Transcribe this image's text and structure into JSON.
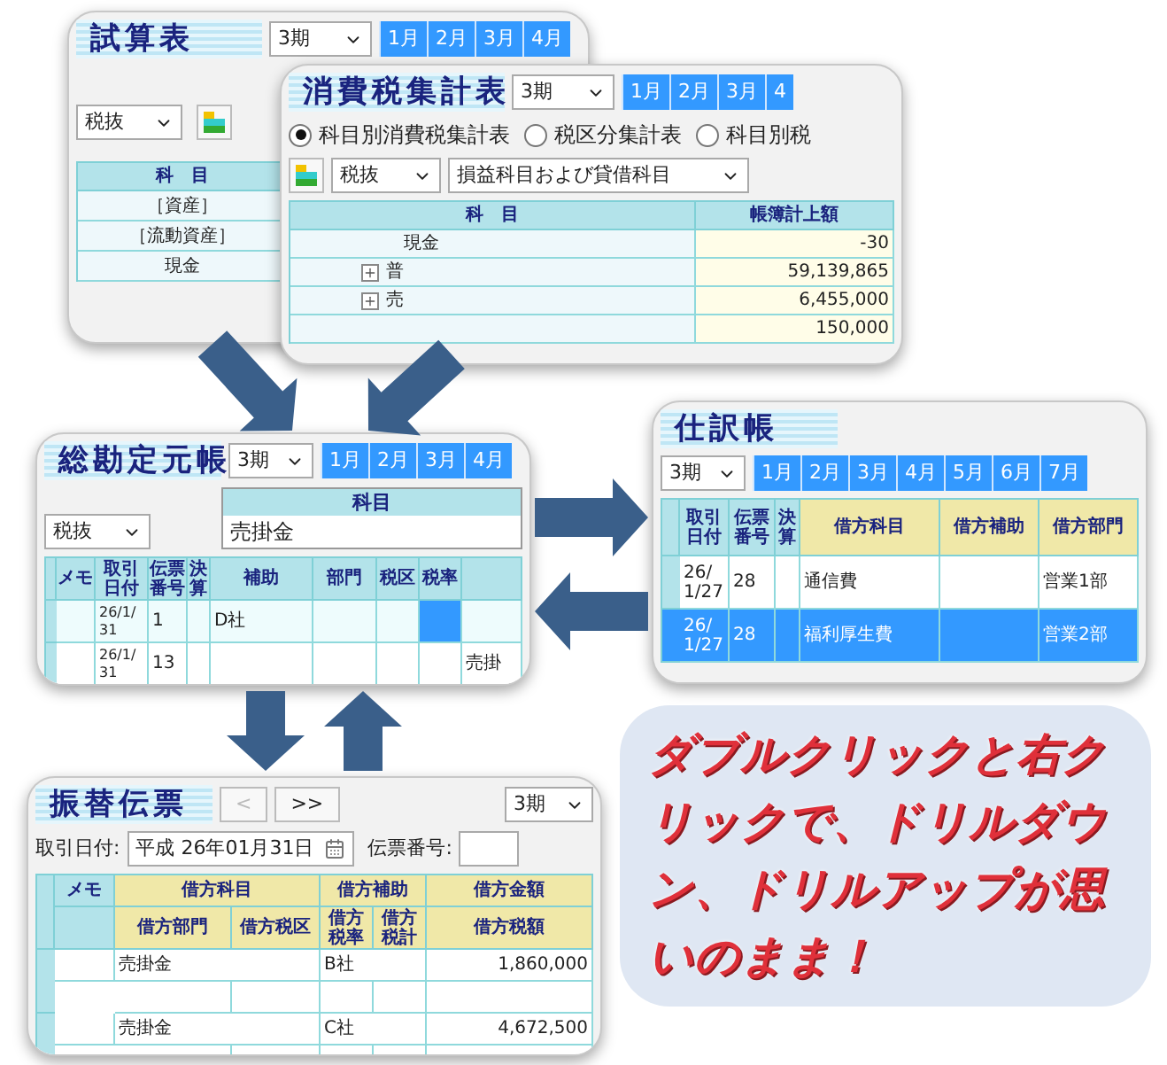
{
  "trial_balance": {
    "title": "試算表",
    "period": "3期",
    "months": [
      "1月",
      "2月",
      "3月",
      "4月"
    ],
    "tax_mode": "税抜",
    "table": {
      "columns": [
        "科　目"
      ],
      "rows": [
        "［資産］",
        "［流動資産］",
        "現金"
      ]
    }
  },
  "consumption_tax": {
    "title": "消費税集計表",
    "period": "3期",
    "months": [
      "1月",
      "2月",
      "3月",
      "4"
    ],
    "radios": [
      {
        "label": "科目別消費税集計表",
        "selected": true
      },
      {
        "label": "税区分集計表",
        "selected": false
      },
      {
        "label": "科目別税",
        "selected": false
      }
    ],
    "tax_mode": "税抜",
    "scope": "損益科目および貸借科目",
    "table": {
      "columns": [
        "科　目",
        "帳簿計上額"
      ],
      "rows": [
        {
          "name": "現金",
          "expandable": false,
          "amount": "-30"
        },
        {
          "name": "普",
          "expandable": true,
          "amount": "59,139,865"
        },
        {
          "name": "売",
          "expandable": true,
          "amount": "6,455,000"
        },
        {
          "expandable": false,
          "amount": "150,000"
        }
      ]
    }
  },
  "general_ledger": {
    "title": "総勘定元帳",
    "period": "3期",
    "months": [
      "1月",
      "2月",
      "3月",
      "4月"
    ],
    "tax_mode": "税抜",
    "account_label": "科目",
    "account": "売掛金",
    "table": {
      "columns": [
        "メモ",
        "取引日付",
        "伝票番号",
        "決算",
        "補助",
        "部門",
        "税区",
        "税率"
      ],
      "rows": [
        {
          "date": "26/1/31",
          "slip_no": "1",
          "sub_account": "D社",
          "selected": true
        },
        {
          "date": "26/1/31",
          "slip_no": "13",
          "column_9": "売掛",
          "selected": false
        }
      ]
    }
  },
  "journal": {
    "title": "仕訳帳",
    "period": "3期",
    "months": [
      "1月",
      "2月",
      "3月",
      "4月",
      "5月",
      "6月",
      "7月"
    ],
    "table": {
      "columns": [
        "取引日付",
        "伝票番号",
        "決算",
        "借方科目",
        "借方補助",
        "借方部門"
      ],
      "rows": [
        {
          "date": "26/1/27",
          "slip_no": "28",
          "account": "通信費",
          "department": "営業1部",
          "selected": false
        },
        {
          "date": "26/1/27",
          "slip_no": "28",
          "account": "福利厚生費",
          "department": "営業2部",
          "selected": true
        }
      ]
    }
  },
  "transfer_slip": {
    "title": "振替伝票",
    "nav": [
      {
        "label": "<",
        "disabled": true
      },
      {
        "label": ">>",
        "disabled": false
      }
    ],
    "period": "3期",
    "date_label": "取引日付:",
    "date": "平成 26年01月31日",
    "slip_no_label": "伝票番号:",
    "header_top": [
      "メモ",
      "借方科目",
      "借方補助",
      "借方金額"
    ],
    "header_bottom": [
      "借方部門",
      "借方税区",
      "借方税率",
      "借方税計",
      "借方税額"
    ],
    "entries": [
      {
        "account": "売掛金",
        "sub_account": "B社",
        "amount": "1,860,000"
      },
      {
        "account": "売掛金",
        "sub_account": "C社",
        "amount": "4,672,500"
      }
    ]
  },
  "callout": {
    "text": "ダブルクリックと右クリックで、ドリルダウン、ドリルアップが思いのまま！"
  }
}
